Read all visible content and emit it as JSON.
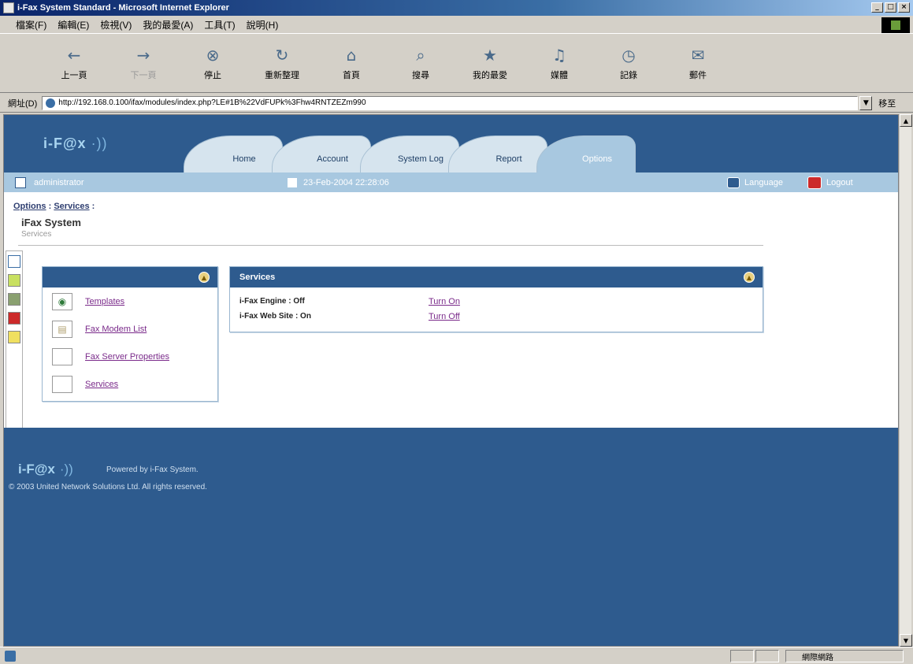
{
  "window": {
    "title": "i-Fax System Standard - Microsoft Internet Explorer"
  },
  "menubar": [
    "檔案(F)",
    "編輯(E)",
    "檢視(V)",
    "我的最愛(A)",
    "工具(T)",
    "說明(H)"
  ],
  "toolbar": [
    {
      "label": "上一頁",
      "icon": "back-icon",
      "glyph": "←"
    },
    {
      "label": "下一頁",
      "icon": "forward-icon",
      "glyph": "→"
    },
    {
      "label": "停止",
      "icon": "stop-icon",
      "glyph": "⊗"
    },
    {
      "label": "重新整理",
      "icon": "refresh-icon",
      "glyph": "↻"
    },
    {
      "label": "首頁",
      "icon": "home-icon",
      "glyph": "⌂"
    },
    {
      "label": "搜尋",
      "icon": "search-icon",
      "glyph": "⌕"
    },
    {
      "label": "我的最愛",
      "icon": "favorites-icon",
      "glyph": "★"
    },
    {
      "label": "媒體",
      "icon": "media-icon",
      "glyph": "♫"
    },
    {
      "label": "記錄",
      "icon": "history-icon",
      "glyph": "◷"
    },
    {
      "label": "郵件",
      "icon": "mail-icon",
      "glyph": "✉"
    }
  ],
  "addressbar": {
    "label": "網址(D)",
    "url": "http://192.168.0.100/ifax/modules/index.php?LE#1B%22VdFUPk%3Fhw4RNTZEZm990",
    "go_label": "移至"
  },
  "app": {
    "logo": "i-F@x",
    "tabs": [
      "Home",
      "Account",
      "System Log",
      "Report",
      "Options"
    ],
    "active_tab": 4,
    "user": "administrator",
    "date": "23-Feb-2004 22:28:06",
    "language": "Language",
    "logout": "Logout",
    "breadcrumb": [
      "Options",
      "Services"
    ],
    "title": "iFax System",
    "subtitle": "Services"
  },
  "options_menu": [
    {
      "label": "Templates",
      "icon": "templates-icon"
    },
    {
      "label": "Fax Modem List",
      "icon": "fax-modem-icon"
    },
    {
      "label": "Fax Server Properties",
      "icon": "server-properties-icon"
    },
    {
      "label": "Services",
      "icon": "services-icon"
    }
  ],
  "services_panel": {
    "title": "Services",
    "rows": [
      {
        "label": "i-Fax Engine : Off",
        "action": "Turn On"
      },
      {
        "label": "i-Fax Web Site : On",
        "action": "Turn Off"
      }
    ]
  },
  "footer": {
    "logo": "i-F@x",
    "powered": "Powered by i-Fax System.",
    "copyright": "© 2003 United Network Solutions Ltd. All rights reserved."
  },
  "statusbar": {
    "zone": "網際網路"
  }
}
